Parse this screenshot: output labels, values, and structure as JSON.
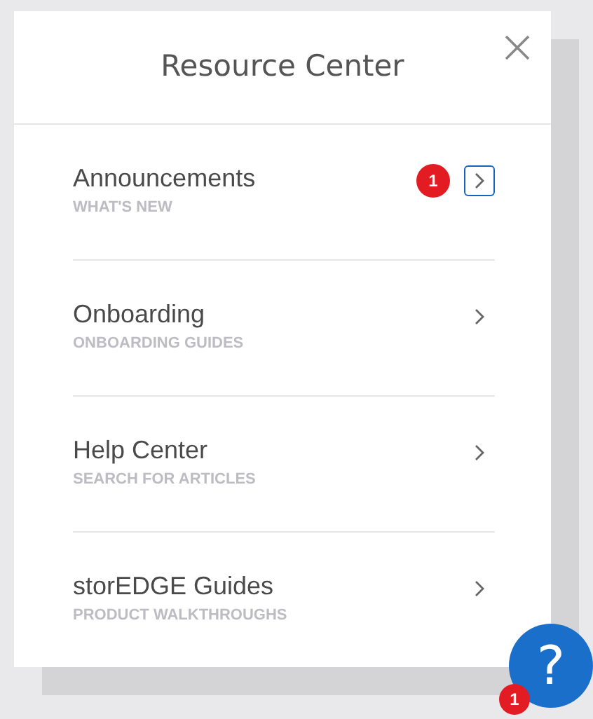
{
  "panel": {
    "title": "Resource Center"
  },
  "items": [
    {
      "title": "Announcements",
      "subtitle": "WHAT'S NEW",
      "badge": "1",
      "selected": true
    },
    {
      "title": "Onboarding",
      "subtitle": "ONBOARDING GUIDES",
      "selected": false
    },
    {
      "title": "Help Center",
      "subtitle": "SEARCH FOR ARTICLES",
      "selected": false
    },
    {
      "title": "storEDGE Guides",
      "subtitle": "PRODUCT WALKTHROUGHS",
      "selected": false
    }
  ],
  "help_button": {
    "label": "?",
    "badge": "1"
  }
}
